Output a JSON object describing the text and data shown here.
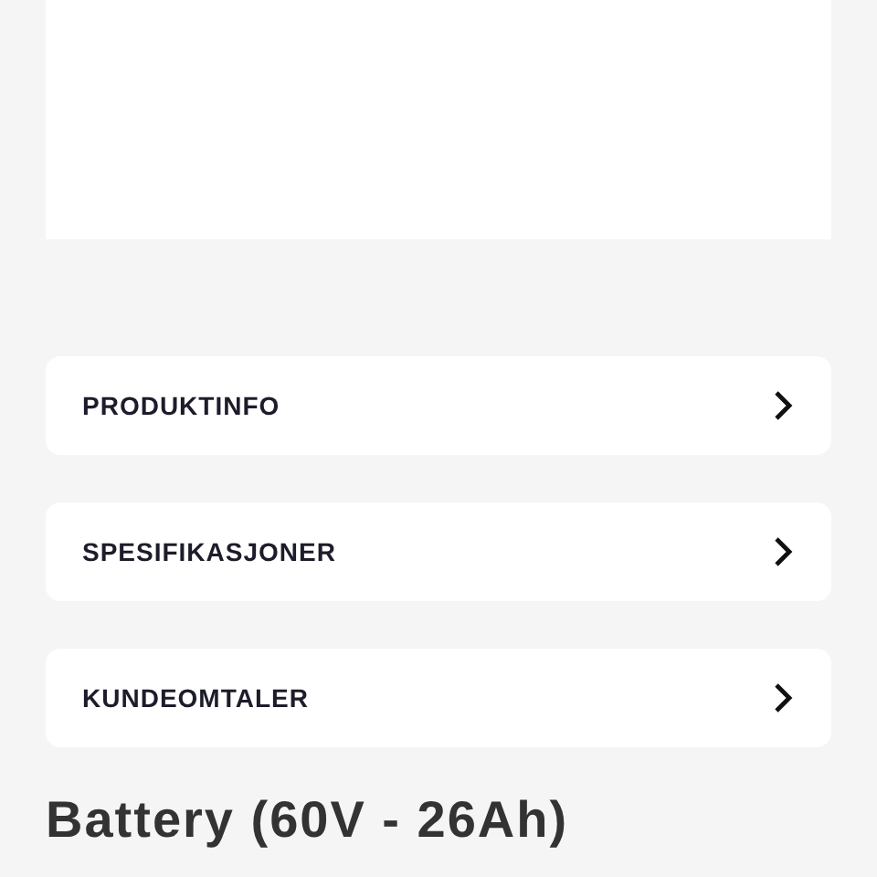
{
  "sections": [
    {
      "label": "PRODUKTINFO",
      "expanded": false
    },
    {
      "label": "SPESIFIKASJONER",
      "expanded": false
    },
    {
      "label": "KUNDEOMTALER",
      "expanded": false
    }
  ],
  "product_title": "Battery (60V - 26Ah)"
}
